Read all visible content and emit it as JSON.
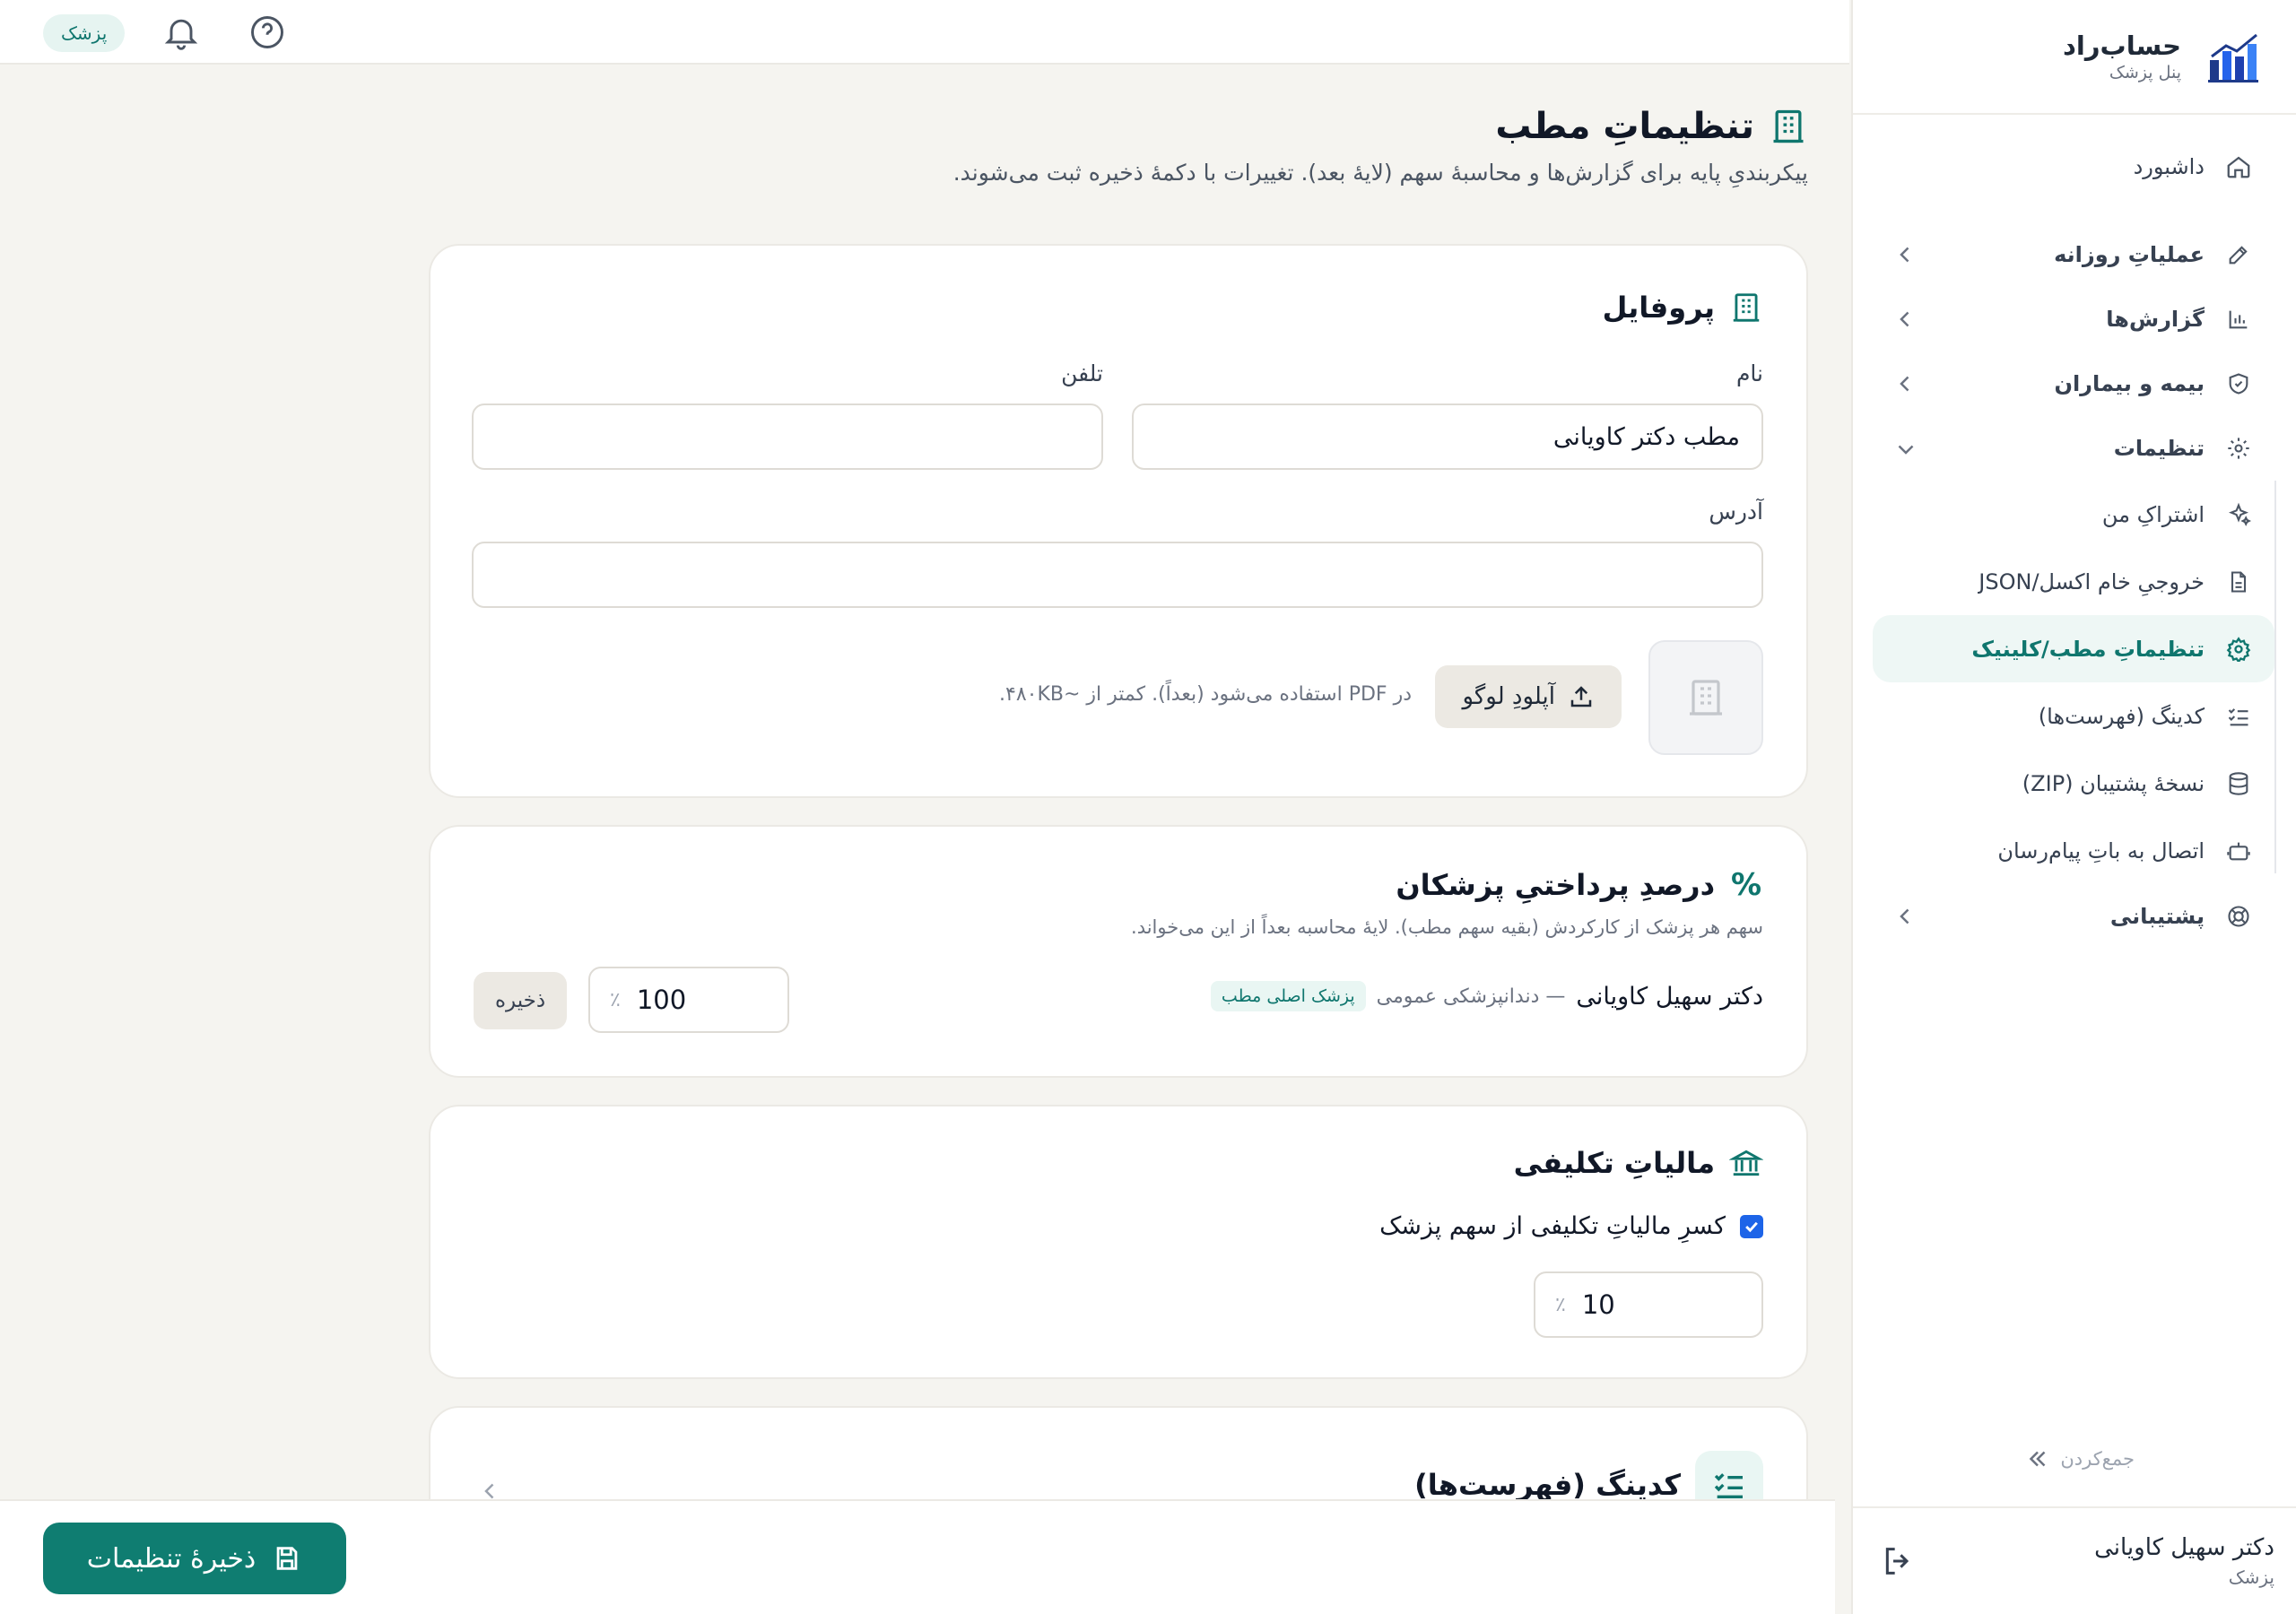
{
  "brand": {
    "name": "حساب‌راد",
    "subtitle": "پنل پزشک"
  },
  "topbar": {
    "role_badge": "پزشک"
  },
  "sidebar": {
    "items": [
      {
        "label": "داشبورد",
        "icon": "home-icon"
      },
      {
        "label": "عملیاتِ روزانه",
        "icon": "pencil-icon"
      },
      {
        "label": "گزارش‌ها",
        "icon": "chart-icon"
      },
      {
        "label": "بیمه و بیماران",
        "icon": "shield-icon"
      },
      {
        "label": "تنظیمات",
        "icon": "gear-icon"
      },
      {
        "label": "پشتیبانی",
        "icon": "lifebuoy-icon"
      }
    ],
    "settings_sub": [
      {
        "label": "اشتراکِ من",
        "icon": "sparkles-icon"
      },
      {
        "label": "خروجیِ خام اکسل/JSON",
        "icon": "file-icon"
      },
      {
        "label": "تنظیماتِ مطب/کلینیک",
        "icon": "gear-icon",
        "active": true
      },
      {
        "label": "کدینگ (فهرست‌ها)",
        "icon": "list-check-icon"
      },
      {
        "label": "نسخهٔ پشتیبان (ZIP)",
        "icon": "database-icon"
      },
      {
        "label": "اتصال به باتِ پیام‌رسان",
        "icon": "bot-icon"
      }
    ],
    "collapse_label": "جمع‌کردن"
  },
  "user": {
    "name": "دکتر سهیل کاویانی",
    "role": "پزشک"
  },
  "page": {
    "title": "تنظیماتِ مطب",
    "description": "پیکربندیِ پایه برای گزارش‌ها و محاسبهٔ سهم (لایهٔ بعد). تغییرات با دکمهٔ ذخیره ثبت می‌شوند."
  },
  "profile": {
    "title": "پروفایل",
    "name_label": "نام",
    "name_value": "مطب دکتر کاویانی",
    "phone_label": "تلفن",
    "phone_value": "",
    "address_label": "آدرس",
    "address_value": "",
    "upload_label": "آپلودِ لوگو",
    "upload_hint": "در PDF استفاده می‌شود (بعداً). کمتر از ~۴۸۰KB."
  },
  "payout": {
    "title": "درصدِ پرداختیِ پزشکان",
    "description": "سهم هر پزشک از کارکردش (بقیه سهم مطب). لایهٔ محاسبه بعداً از این می‌خواند.",
    "doctor_name": "دکتر سهیل کاویانی",
    "doctor_specialty": "— دندانپزشکی عمومی",
    "doctor_tag": "پزشک اصلی مطب",
    "percent_value": "100",
    "percent_sign": "٪",
    "save_label": "ذخیره"
  },
  "tax": {
    "title": "مالیاتِ تکلیفی",
    "checkbox_label": "کسرِ مالیاتِ تکلیفی از سهم پزشک",
    "checked": true,
    "percent_value": "10",
    "percent_sign": "٪"
  },
  "coding": {
    "title": "کدینگ (فهرست‌ها)"
  },
  "footer": {
    "save_label": "ذخیرهٔ تنظیمات"
  },
  "colors": {
    "accent": "#0f7d71",
    "checkbox": "#1d64e8",
    "active_bg": "#eef7f5"
  }
}
